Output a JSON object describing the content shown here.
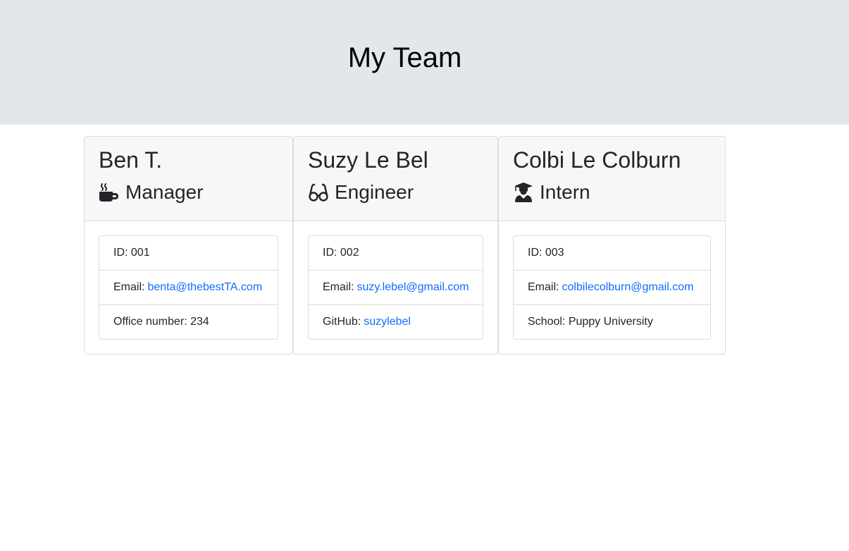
{
  "header": {
    "title": "My Team"
  },
  "colors": {
    "link": "#0d6efd",
    "jumbotron": "#e4e7ea",
    "card_header": "#f7f7f7"
  },
  "cards": [
    {
      "name": "Ben T.",
      "role": "Manager",
      "icon": "coffee-mug-icon",
      "id_label": "ID: 001",
      "email_label": "Email:",
      "email": "benta@thebestTA.com",
      "extra_label": "Office number: 234"
    },
    {
      "name": "Suzy Le Bel",
      "role": "Engineer",
      "icon": "glasses-icon",
      "id_label": "ID: 002",
      "email_label": "Email:",
      "email": "suzy.lebel@gmail.com",
      "extra_label": "GitHub:",
      "extra_link": "suzylebel"
    },
    {
      "name": "Colbi Le Colburn",
      "role": "Intern",
      "icon": "graduate-icon",
      "id_label": "ID: 003",
      "email_label": "Email:",
      "email": "colbilecolburn@gmail.com",
      "extra_label": "School: Puppy University"
    }
  ]
}
